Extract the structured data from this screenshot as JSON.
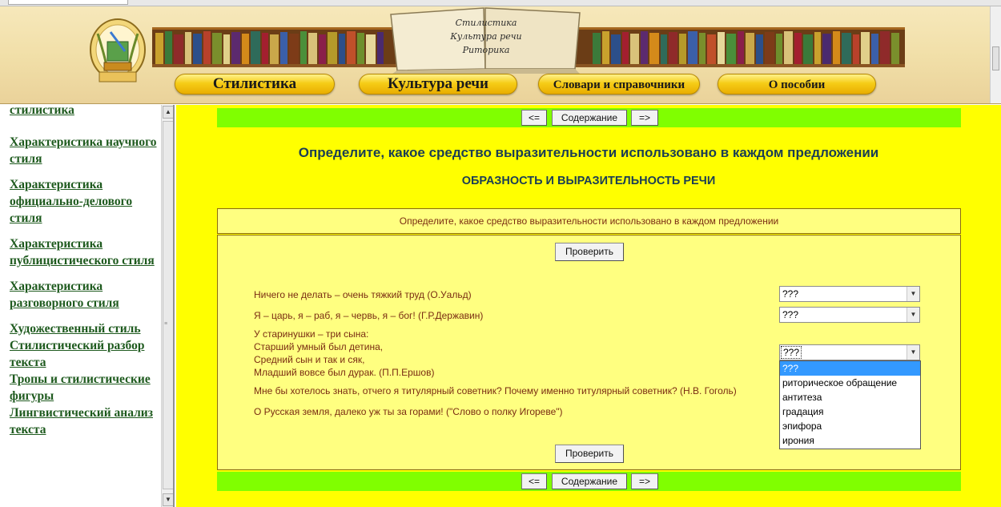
{
  "header": {
    "book_lines": [
      "Стилистика",
      "Культура речи",
      "Риторика"
    ],
    "nav": [
      "Стилистика",
      "Культура речи",
      "Словари и справочники",
      "О пособии"
    ]
  },
  "sidebar": {
    "links": [
      "стилистика",
      "Характеристика научного стиля",
      "Характеристика официально-делового стиля",
      "Характеристика публицистического стиля",
      "Характеристика разговорного стиля",
      "Художественный стиль",
      "Стилистический разбор текста",
      "Тропы и стилистические фигуры",
      "Лингвистический анализ текста"
    ]
  },
  "navbar": {
    "prev": "<=",
    "contents": "Содержание",
    "next": "=>"
  },
  "main": {
    "heading": "Определите, какое средство выразительности использовано в каждом предложении",
    "subheading": "ОБРАЗНОСТЬ И ВЫРАЗИТЕЛЬНОСТЬ РЕЧИ",
    "task": "Определите, какое средство выразительности использовано в каждом предложении",
    "check_label": "Проверить",
    "questions": [
      "Ничего не делать – очень тяжкий труд (О.Уальд)",
      "Я – царь, я – раб, я – червь, я – бог! (Г.Р.Державин)",
      "У старинушки – три сына:",
      "Старший умный был детина,",
      "Средний сын и так и сяк,",
      "Младший вовсе был дурак. (П.П.Ершов)",
      "Мне бы хотелось знать, отчего я титулярный советник? Почему именно титулярный советник? (Н.В. Гоголь)",
      "О Русская земля, далеко уж ты за горами! (\"Слово о полку Игореве\")"
    ],
    "selects": [
      "???",
      "???",
      "???"
    ],
    "dropdown_options": [
      "???",
      "риторическое обращение",
      "антитеза",
      "градация",
      "эпифора",
      "ирония"
    ]
  },
  "colors": {
    "main_bg": "#ffff00",
    "navbar_bg": "#80ff00",
    "panel_bg": "#ffff80",
    "heading_text": "#1a3d55",
    "question_text": "#7a2c12",
    "sidebar_link": "#1e5a1e",
    "dropdown_highlight": "#3399ff"
  }
}
